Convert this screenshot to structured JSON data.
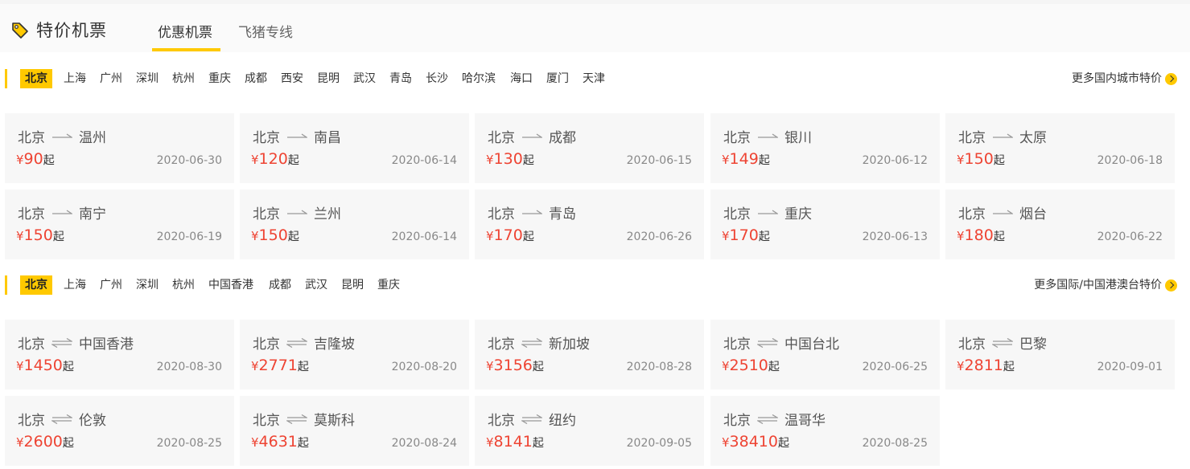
{
  "header": {
    "title": "特价机票",
    "tabs": [
      "优惠机票",
      "飞猪专线"
    ]
  },
  "colors": {
    "accent": "#ffc900",
    "price": "#ee4433"
  },
  "domestic": {
    "cities": [
      "北京",
      "上海",
      "广州",
      "深圳",
      "杭州",
      "重庆",
      "成都",
      "西安",
      "昆明",
      "武汉",
      "青岛",
      "长沙",
      "哈尔滨",
      "海口",
      "厦门",
      "天津"
    ],
    "more": "更多国内城市特价",
    "cards": [
      {
        "from": "北京",
        "to": "温州",
        "currency": "¥",
        "price": "90",
        "suffix": "起",
        "date": "2020-06-30"
      },
      {
        "from": "北京",
        "to": "南昌",
        "currency": "¥",
        "price": "120",
        "suffix": "起",
        "date": "2020-06-14"
      },
      {
        "from": "北京",
        "to": "成都",
        "currency": "¥",
        "price": "130",
        "suffix": "起",
        "date": "2020-06-15"
      },
      {
        "from": "北京",
        "to": "银川",
        "currency": "¥",
        "price": "149",
        "suffix": "起",
        "date": "2020-06-12"
      },
      {
        "from": "北京",
        "to": "太原",
        "currency": "¥",
        "price": "150",
        "suffix": "起",
        "date": "2020-06-18"
      },
      {
        "from": "北京",
        "to": "南宁",
        "currency": "¥",
        "price": "150",
        "suffix": "起",
        "date": "2020-06-19"
      },
      {
        "from": "北京",
        "to": "兰州",
        "currency": "¥",
        "price": "150",
        "suffix": "起",
        "date": "2020-06-14"
      },
      {
        "from": "北京",
        "to": "青岛",
        "currency": "¥",
        "price": "170",
        "suffix": "起",
        "date": "2020-06-26"
      },
      {
        "from": "北京",
        "to": "重庆",
        "currency": "¥",
        "price": "170",
        "suffix": "起",
        "date": "2020-06-13"
      },
      {
        "from": "北京",
        "to": "烟台",
        "currency": "¥",
        "price": "180",
        "suffix": "起",
        "date": "2020-06-22"
      }
    ]
  },
  "international": {
    "cities": [
      "北京",
      "上海",
      "广州",
      "深圳",
      "杭州",
      "中国香港",
      "成都",
      "武汉",
      "昆明",
      "重庆"
    ],
    "more": "更多国际/中国港澳台特价",
    "cards": [
      {
        "from": "北京",
        "to": "中国香港",
        "currency": "¥",
        "price": "1450",
        "suffix": "起",
        "date": "2020-08-30"
      },
      {
        "from": "北京",
        "to": "吉隆坡",
        "currency": "¥",
        "price": "2771",
        "suffix": "起",
        "date": "2020-08-20"
      },
      {
        "from": "北京",
        "to": "新加坡",
        "currency": "¥",
        "price": "3156",
        "suffix": "起",
        "date": "2020-08-28"
      },
      {
        "from": "北京",
        "to": "中国台北",
        "currency": "¥",
        "price": "2510",
        "suffix": "起",
        "date": "2020-06-25"
      },
      {
        "from": "北京",
        "to": "巴黎",
        "currency": "¥",
        "price": "2811",
        "suffix": "起",
        "date": "2020-09-01"
      },
      {
        "from": "北京",
        "to": "伦敦",
        "currency": "¥",
        "price": "2600",
        "suffix": "起",
        "date": "2020-08-25"
      },
      {
        "from": "北京",
        "to": "莫斯科",
        "currency": "¥",
        "price": "4631",
        "suffix": "起",
        "date": "2020-08-24"
      },
      {
        "from": "北京",
        "to": "纽约",
        "currency": "¥",
        "price": "8141",
        "suffix": "起",
        "date": "2020-09-05"
      },
      {
        "from": "北京",
        "to": "温哥华",
        "currency": "¥",
        "price": "38410",
        "suffix": "起",
        "date": "2020-08-25"
      }
    ]
  }
}
